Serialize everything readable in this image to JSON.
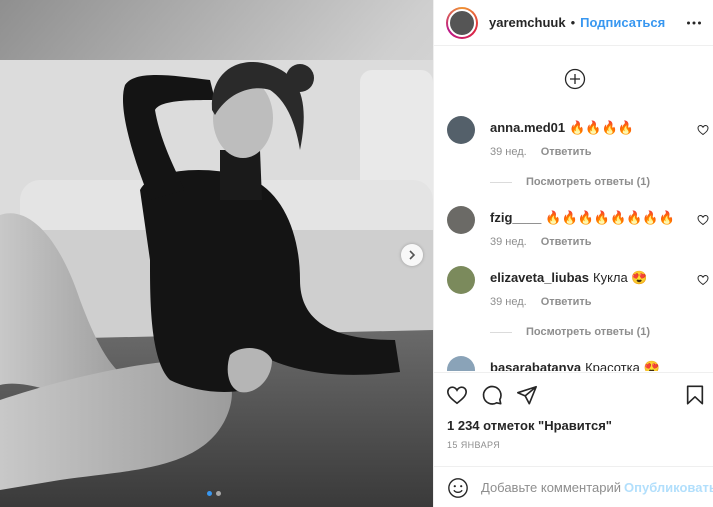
{
  "header": {
    "username": "yaremchuuk",
    "separator": "•",
    "follow_label": "Подписаться"
  },
  "comments": [
    {
      "user": "anna.med01",
      "text": "🔥🔥🔥🔥",
      "time": "39 нед.",
      "reply": "Ответить",
      "view_replies": "Посмотреть ответы (1)"
    },
    {
      "user": "fzig____",
      "text": "🔥🔥🔥🔥🔥🔥🔥🔥",
      "time": "39 нед.",
      "reply": "Ответить"
    },
    {
      "user": "elizaveta_liubas",
      "text": "Кукла 😍",
      "time": "39 нед.",
      "reply": "Ответить",
      "view_replies": "Посмотреть ответы (1)"
    },
    {
      "user": "basarabatanya",
      "text": "Красотка 😍"
    }
  ],
  "likes_text": "1 234 отметок \"Нравится\"",
  "date_text": "15 ЯНВАРЯ",
  "add_comment": {
    "placeholder": "Добавьте комментарий...",
    "publish_label": "Опубликовать"
  },
  "icons": {
    "more": "more-horizontal-icon",
    "plus": "plus-circle-icon",
    "heart": "heart-icon",
    "comment": "comment-icon",
    "share": "paper-plane-icon",
    "save": "bookmark-icon",
    "emoji": "smiley-icon",
    "next": "chevron-right-icon"
  },
  "colors": {
    "link": "#3897f0",
    "publish_disabled": "#b2dffc",
    "muted": "#8e8e8e"
  },
  "carousel": {
    "slides": 2,
    "current": 1
  }
}
